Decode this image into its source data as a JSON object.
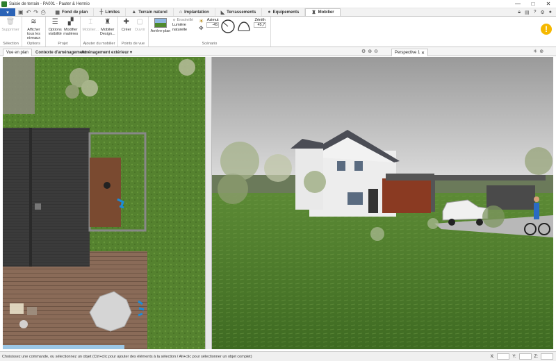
{
  "window": {
    "title": "Saisie de terrain - PA001 - Pauter & Hermio",
    "controls": [
      "—",
      "□",
      "✕"
    ]
  },
  "ribbon_tabs": [
    {
      "label": "Fond de plan",
      "icon": "map-icon"
    },
    {
      "label": "Limites",
      "icon": "fence-icon"
    },
    {
      "label": "Terrain naturel",
      "icon": "mountain-icon"
    },
    {
      "label": "Implantation",
      "icon": "house-icon"
    },
    {
      "label": "Terrassements",
      "icon": "excavator-icon"
    },
    {
      "label": "Equipements",
      "icon": "pin-icon"
    },
    {
      "label": "Mobilier",
      "icon": "chair-icon",
      "active": true
    }
  ],
  "ribbon_groups": {
    "selection": {
      "label": "Sélection",
      "tools": [
        {
          "label": "Supprimer",
          "icon": "trash-icon",
          "disabled": true
        }
      ]
    },
    "options": {
      "label": "Options",
      "tools": [
        {
          "label": "Afficher tous les niveaux",
          "icon": "layers-icon"
        }
      ]
    },
    "projet": {
      "label": "Projet",
      "tools": [
        {
          "label": "Options visibilité",
          "icon": "list-icon"
        },
        {
          "label": "Modifier matières",
          "icon": "palette-icon"
        }
      ]
    },
    "mobilier": {
      "label": "Ajouter du mobilier",
      "tools": [
        {
          "label": "Mobilier...",
          "icon": "sofa-icon",
          "disabled": true
        },
        {
          "label": "Mobilier Design...",
          "icon": "armchair-icon"
        }
      ]
    },
    "points": {
      "label": "Points de vue",
      "tools": [
        {
          "label": "Créer",
          "icon": "camera-icon"
        },
        {
          "label": "Ouvrir",
          "icon": "folder-icon",
          "disabled": true
        }
      ]
    },
    "scenario": {
      "label": "Scénario",
      "arriere_plan": "Arrière-plan",
      "ensoleille": "Ensoleillé",
      "lumiere": "Lumière naturelle",
      "azimut_label": "Azimut",
      "azimut_value": "-45",
      "zenith_label": "Zénith",
      "zenith_value": "45,7"
    }
  },
  "doc_tabs": {
    "left_view": "Vue en plan",
    "left_sub1": "Contexte d'aménagement",
    "left_sub2": "Aménagement extérieur",
    "right_view": "Perspective 1"
  },
  "status": {
    "message": "Choisissez une commande, ou sélectionnez un objet (Ctrl+clic pour ajouter des éléments à la sélection / Alt+clic pour sélectionner un objet complet)",
    "x_label": "X:",
    "y_label": "Y:",
    "z_label": "Z:"
  },
  "colors": {
    "accent": "#2b63b6",
    "grass": "#4e7b2a",
    "warning": "#f5b800"
  }
}
